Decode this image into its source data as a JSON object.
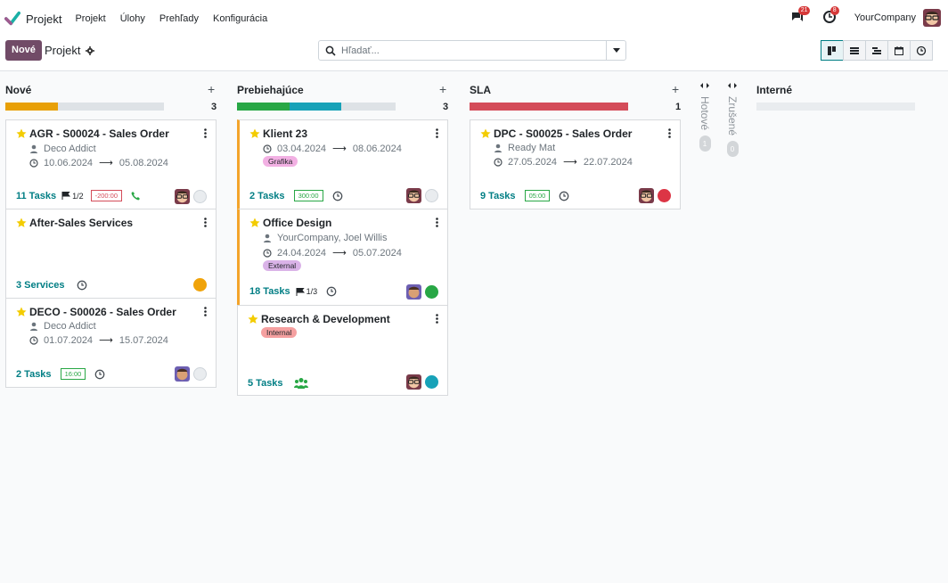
{
  "app": {
    "name": "Projekt",
    "brand_icon": "check-logo-icon"
  },
  "menu": [
    "Projekt",
    "Úlohy",
    "Prehľady",
    "Konfigurácia"
  ],
  "nav": {
    "messages_count": "21",
    "activities_count": "8",
    "company": "YourCompany"
  },
  "control": {
    "new_label": "Nové",
    "breadcrumb": "Projekt",
    "search_placeholder": "Hľadať..."
  },
  "views": [
    "kanban",
    "list",
    "gantt",
    "calendar",
    "activity"
  ],
  "columns": [
    {
      "title": "Nové",
      "count": "3",
      "progress": [
        {
          "color": "#e8a006",
          "pct": 0.33
        },
        {
          "color": "#dee2e6",
          "pct": 0.67
        }
      ],
      "cards": [
        {
          "title": "AGR - S00024 - Sales Order",
          "customer": "Deco Addict",
          "date_start": "10.06.2024",
          "date_end": "05.08.2024",
          "tasks": "11 Tasks",
          "milestones": "1/2",
          "time": "-200:00",
          "time_style": "red",
          "extra_icon": "phone-icon",
          "status": "grey"
        },
        {
          "title": "After-Sales Services",
          "tasks": "3 Services",
          "extra_icon": "clock-icon",
          "status": "orange"
        },
        {
          "title": "DECO - S00026 - Sales Order",
          "customer": "Deco Addict",
          "date_start": "01.07.2024",
          "date_end": "15.07.2024",
          "tasks": "2 Tasks",
          "time": "16:00",
          "time_style": "green",
          "extra_icon": "clock-icon",
          "status": "grey"
        }
      ]
    },
    {
      "title": "Prebiehajúce",
      "count": "3",
      "progress": [
        {
          "color": "#28a745",
          "pct": 0.33
        },
        {
          "color": "#17a2b8",
          "pct": 0.33
        },
        {
          "color": "#dee2e6",
          "pct": 0.34
        }
      ],
      "cards": [
        {
          "title": "Klient 23",
          "date_start": "03.04.2024",
          "date_end": "08.06.2024",
          "tag": "Grafika",
          "tag_color": "#f2b0e3",
          "tasks": "2 Tasks",
          "time": "300:00",
          "time_style": "green",
          "extra_icon": "clock-icon",
          "status": "grey"
        },
        {
          "title": "Office Design",
          "customer": "YourCompany, Joel Willis",
          "date_start": "24.04.2024",
          "date_end": "05.07.2024",
          "tag": "External",
          "tag_color": "#dab3e8",
          "tasks": "18 Tasks",
          "milestones": "1/3",
          "extra_icon": "clock-icon",
          "status": "green"
        },
        {
          "title": "Research & Development",
          "tag": "Internal",
          "tag_color": "#f5a0a0",
          "tasks": "5 Tasks",
          "extra_icon": "users-icon",
          "status": "teal"
        }
      ]
    },
    {
      "title": "SLA",
      "count": "1",
      "progress": [
        {
          "color": "#d44c59",
          "pct": 1
        }
      ],
      "cards": [
        {
          "title": "DPC - S00025 - Sales Order",
          "customer": "Ready Mat",
          "date_start": "27.05.2024",
          "date_end": "22.07.2024",
          "tasks": "9 Tasks",
          "time": "05:00",
          "time_style": "green",
          "extra_icon": "clock-icon",
          "status": "red"
        }
      ]
    }
  ],
  "folded": [
    {
      "title": "Hotové",
      "count": "1"
    },
    {
      "title": "Zrušené",
      "count": "0"
    }
  ],
  "empty_column": {
    "title": "Interné"
  },
  "colors": {
    "accent": "#714b67",
    "link": "#017e84"
  }
}
